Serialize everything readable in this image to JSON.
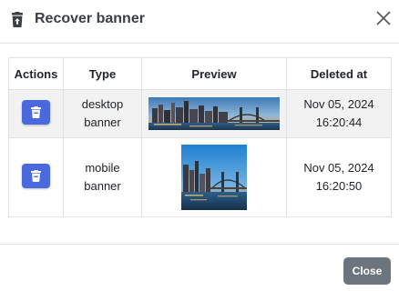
{
  "modal": {
    "title": "Recover banner",
    "title_icon": "trash-restore-icon",
    "close_icon": "close-icon"
  },
  "table": {
    "headers": [
      "Actions",
      "Type",
      "Preview",
      "Deleted at"
    ],
    "rows": [
      {
        "action_icon": "trash-icon",
        "type_line1": "desktop",
        "type_line2": "banner",
        "preview": "city skyline bridge at dusk (wide)",
        "deleted_date": "Nov 05, 2024",
        "deleted_time": "16:20:44"
      },
      {
        "action_icon": "trash-icon",
        "type_line1": "mobile",
        "type_line2": "banner",
        "preview": "city skyline bridge at dusk (square)",
        "deleted_date": "Nov 05, 2024",
        "deleted_time": "16:20:50"
      }
    ]
  },
  "footer": {
    "close_label": "Close"
  },
  "colors": {
    "primary_button": "#4a69dd",
    "secondary_button": "#6c757d",
    "row_highlight": "#f2f2f2"
  }
}
